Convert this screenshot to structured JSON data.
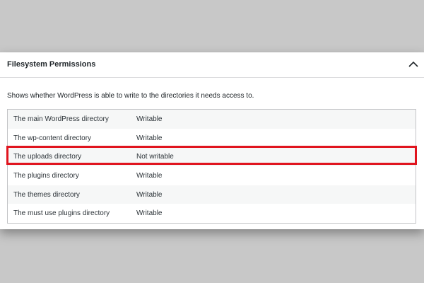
{
  "section": {
    "title": "Filesystem Permissions",
    "toggle_icon": "chevron-up-icon",
    "description": "Shows whether WordPress is able to write to the directories it needs access to."
  },
  "rows": [
    {
      "directory": "The main WordPress directory",
      "status": "Writable"
    },
    {
      "directory": "The wp-content directory",
      "status": "Writable"
    },
    {
      "directory": "The uploads directory",
      "status": "Not writable"
    },
    {
      "directory": "The plugins directory",
      "status": "Writable"
    },
    {
      "directory": "The themes directory",
      "status": "Writable"
    },
    {
      "directory": "The must use plugins directory",
      "status": "Writable"
    }
  ],
  "highlighted_row": 2,
  "colors": {
    "highlight": "#e0141e",
    "background": "#c8c8c8",
    "panel": "#ffffff"
  }
}
